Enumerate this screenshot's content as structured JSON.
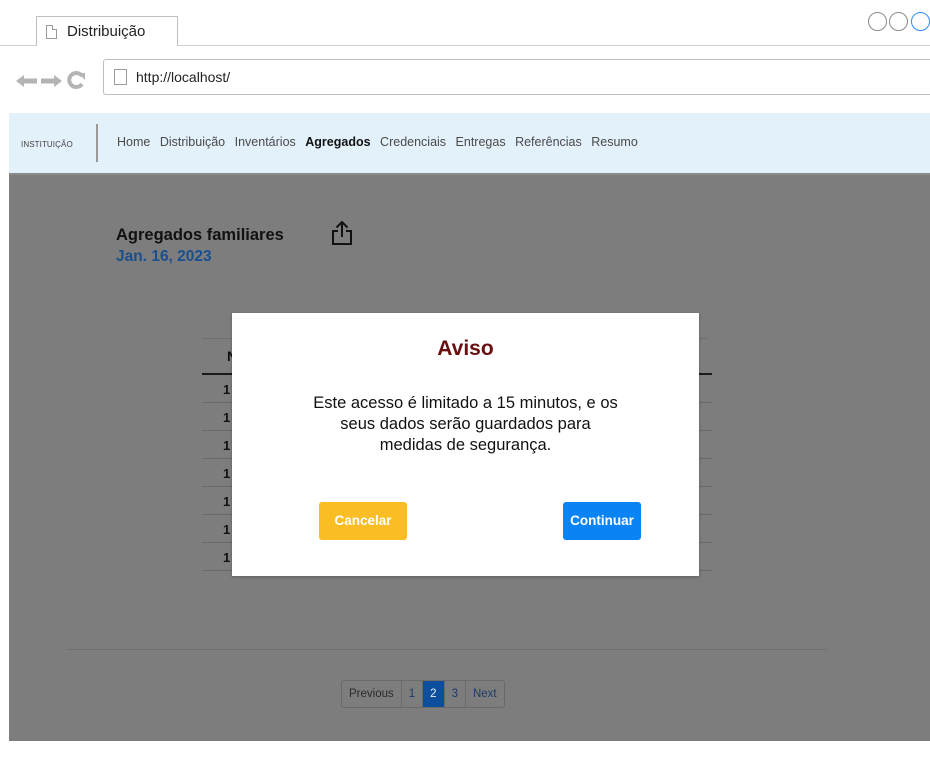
{
  "browser": {
    "tab_title": "Distribuição",
    "url": "http://localhost/"
  },
  "app_nav": {
    "brand": "INSTITUIÇÃO",
    "links": [
      {
        "label": "Home",
        "active": false
      },
      {
        "label": "Distribuição",
        "active": false
      },
      {
        "label": "Inventários",
        "active": false
      },
      {
        "label": "Agregados",
        "active": true
      },
      {
        "label": "Credenciais",
        "active": false
      },
      {
        "label": "Entregas",
        "active": false
      },
      {
        "label": "Referências",
        "active": false
      },
      {
        "label": "Resumo",
        "active": false
      }
    ]
  },
  "page": {
    "title": "Agregados familiares",
    "date": "Jan. 16, 2023",
    "table_header_first": "N",
    "table_row_first_cells": [
      "1",
      "1",
      "1",
      "1",
      "1",
      "1",
      "1"
    ]
  },
  "pagination": {
    "previous": "Previous",
    "pages": [
      "1",
      "2",
      "3"
    ],
    "current": "2",
    "next": "Next"
  },
  "modal": {
    "title": "Aviso",
    "message_lines": [
      "Este acesso é limitado a 15 minutos, e os",
      "seus dados serão guardados para",
      "medidas de segurança."
    ],
    "cancel_label": "Cancelar",
    "continue_label": "Continuar"
  },
  "colors": {
    "overlay": "#7d7d7d",
    "navbar_bg": "#e3f1fb",
    "date_text": "#1a4f8f",
    "modal_title": "#6a0f0f",
    "cancel_button": "#fbbd24",
    "continue_button": "#0a84f5",
    "pagination_active": "#0d4f9c"
  },
  "icons": [
    "page-icon",
    "back-arrow-icon",
    "forward-arrow-icon",
    "reload-icon",
    "share-icon",
    "window-control-icons"
  ]
}
